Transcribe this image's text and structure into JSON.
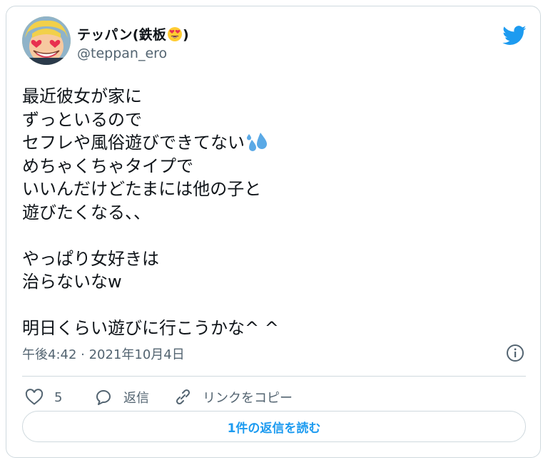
{
  "author": {
    "display_name": "テッパン(鉄板",
    "display_name_suffix": ")",
    "display_name_emoji": "heart-eyes-emoji",
    "handle": "@teppan_ero"
  },
  "tweet": {
    "lines": [
      "最近彼女が家に",
      "ずっといるので",
      "セフレや風俗遊びできてない",
      "めちゃくちゃタイプで",
      "いいんだけどたまには他の子と",
      "遊びたくなる、、",
      "",
      "やっぱり女好きは",
      "治らないなw",
      "",
      "明日くらい遊びに行こうかな^ ^"
    ],
    "sweat_emoji": "sweat-droplets-emoji",
    "timestamp": "午後4:42 · 2021年10月4日"
  },
  "actions": {
    "like_count": "5",
    "reply_label": "返信",
    "copy_link_label": "リンクをコピー"
  },
  "read_replies_label": "1件の返信を読む",
  "colors": {
    "accent": "#1d9bf0",
    "secondary_text": "#536471",
    "border": "#cfd9de",
    "like_icon": "heart-outline-icon"
  }
}
